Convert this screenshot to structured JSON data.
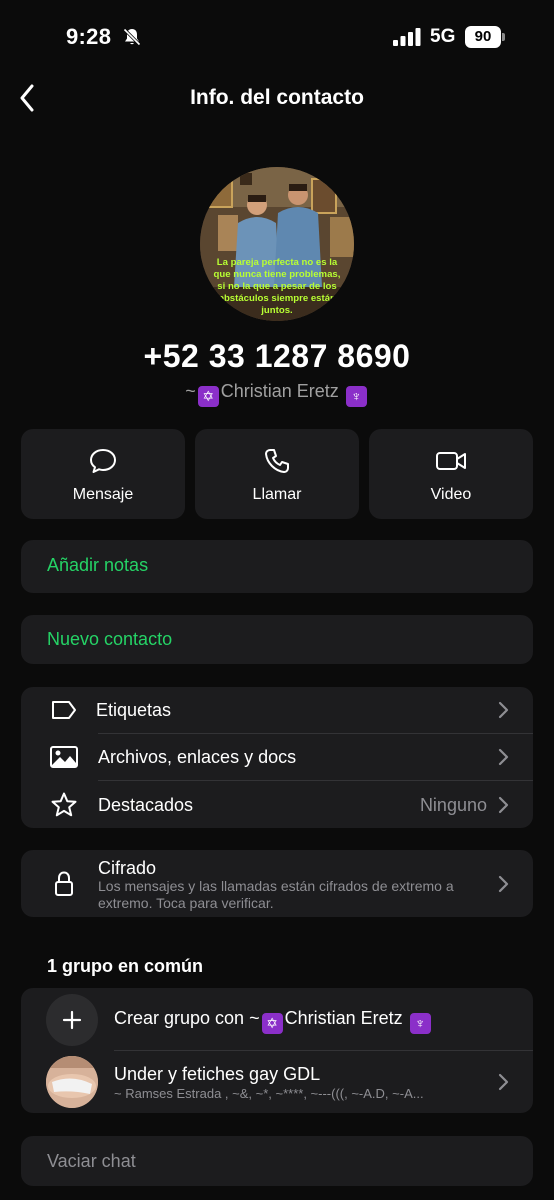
{
  "status": {
    "time": "9:28",
    "network": "5G",
    "battery": "90"
  },
  "nav": {
    "title": "Info. del contacto"
  },
  "avatar": {
    "caption": [
      "La pareja perfecta no es la",
      "que nunca tiene problemas,",
      "si no la que a pesar de los",
      "obstáculos siempre están",
      "juntos."
    ]
  },
  "contact": {
    "phone": "+52 33 1287 8690",
    "name_prefix": "~",
    "name": "Christian Eretz"
  },
  "actions": [
    {
      "label": "Mensaje",
      "icon": "message-bubble-icon"
    },
    {
      "label": "Llamar",
      "icon": "phone-icon"
    },
    {
      "label": "Video",
      "icon": "video-camera-icon"
    }
  ],
  "notes": {
    "label": "Añadir notas"
  },
  "new_contact": {
    "label": "Nuevo contacto"
  },
  "menu": [
    {
      "label": "Etiquetas",
      "icon": "tag-icon",
      "value": ""
    },
    {
      "label": "Archivos, enlaces y docs",
      "icon": "image-icon",
      "value": ""
    },
    {
      "label": "Destacados",
      "icon": "star-icon",
      "value": "Ninguno"
    }
  ],
  "encryption": {
    "title": "Cifrado",
    "description_line1": "Los mensajes y las llamadas están cifrados de extremo a",
    "description_line2": "extremo. Toca para verificar."
  },
  "groups": {
    "heading": "1 grupo en común",
    "create_prefix": "Crear grupo con ~",
    "create_name": "Christian Eretz",
    "group_name": "Under y fetiches gay GDL",
    "group_members": "~ Ramses Estrada , ~&, ~*, ~****, ~---(((, ~-A.D, ~-A..."
  },
  "clear_chat": {
    "label": "Vaciar chat"
  },
  "colors": {
    "accent": "#25d366",
    "card": "#1c1c1e",
    "background": "#0b0b0b",
    "secondary_text": "#8e8e93"
  }
}
